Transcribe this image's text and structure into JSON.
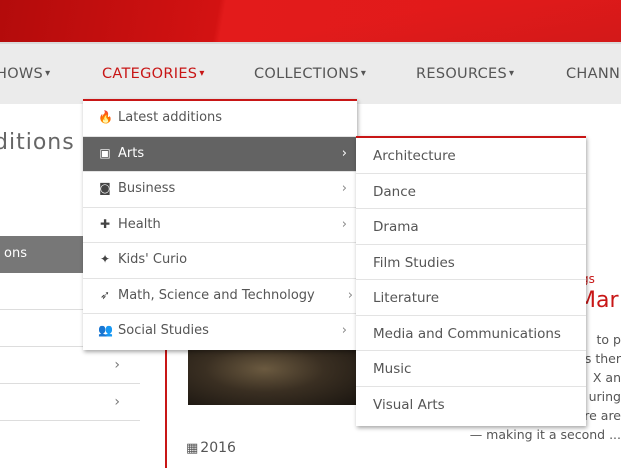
{
  "nav": {
    "items": [
      {
        "label": "HOWS",
        "caret": "▾"
      },
      {
        "label": "CATEGORIES",
        "caret": "▾"
      },
      {
        "label": "COLLECTIONS",
        "caret": "▾"
      },
      {
        "label": "RESOURCES",
        "caret": "▾"
      },
      {
        "label": "CHANN",
        "caret": ""
      }
    ],
    "active_color": "#c81616"
  },
  "page": {
    "heading": "ditions"
  },
  "sidebar": {
    "tab_label": "ons",
    "chevron": "›"
  },
  "dropdown": {
    "items": [
      {
        "icon": "fire-icon",
        "glyph": "🔥",
        "label": "Latest additions",
        "arrow": ""
      },
      {
        "icon": "image-icon",
        "glyph": "▣",
        "label": "Arts",
        "arrow": "›"
      },
      {
        "icon": "money-icon",
        "glyph": "◙",
        "label": "Business",
        "arrow": "›"
      },
      {
        "icon": "medkit-icon",
        "glyph": "✚",
        "label": "Health",
        "arrow": "›"
      },
      {
        "icon": "child-icon",
        "glyph": "✦",
        "label": "Kids' Curio",
        "arrow": ""
      },
      {
        "icon": "rocket-icon",
        "glyph": "➶",
        "label": "Math, Science and Technology",
        "arrow": "›"
      },
      {
        "icon": "users-icon",
        "glyph": "👥",
        "label": "Social Studies",
        "arrow": "›"
      }
    ]
  },
  "submenu": {
    "items": [
      "Architecture",
      "Dance",
      "Drama",
      "Film Studies",
      "Literature",
      "Media and Communications",
      "Music",
      "Visual Arts"
    ]
  },
  "card": {
    "tag": "gs",
    "title": "Mar",
    "body": [
      "to p",
      "s ther",
      "X an",
      "uring",
      "and space law. There are",
      "— making it a second ..."
    ],
    "year": "2016",
    "calendar_icon": "calendar-icon"
  }
}
